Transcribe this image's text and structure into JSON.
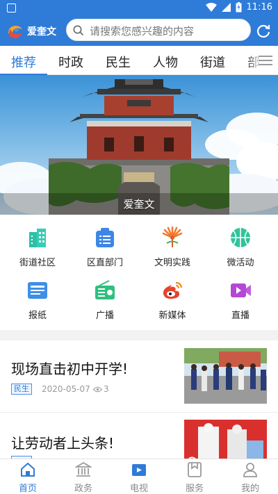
{
  "status_bar": {
    "time": "11:16"
  },
  "header": {
    "brand": "爱奎文",
    "search_placeholder": "请搜索您感兴趣的内容"
  },
  "tabs": [
    {
      "label": "推荐",
      "active": true
    },
    {
      "label": "时政"
    },
    {
      "label": "民生"
    },
    {
      "label": "人物"
    },
    {
      "label": "街道"
    },
    {
      "label": "部"
    }
  ],
  "banner": {
    "caption": "爱奎文"
  },
  "quick_links": [
    {
      "label": "街道社区",
      "icon": "buildings-icon"
    },
    {
      "label": "区直部门",
      "icon": "department-icon"
    },
    {
      "label": "文明实践",
      "icon": "civilization-icon"
    },
    {
      "label": "微活动",
      "icon": "basketball-icon"
    },
    {
      "label": "报纸",
      "icon": "newspaper-icon"
    },
    {
      "label": "广播",
      "icon": "radio-icon"
    },
    {
      "label": "新媒体",
      "icon": "weibo-icon"
    },
    {
      "label": "直播",
      "icon": "live-video-icon"
    }
  ],
  "news": [
    {
      "title": "现场直击初中开学!",
      "tag": "民生",
      "date": "2020-05-07",
      "views": "3"
    },
    {
      "title": "让劳动者上头条!"
    }
  ],
  "bottom_nav": [
    {
      "label": "首页",
      "icon": "home-icon",
      "active": true
    },
    {
      "label": "政务",
      "icon": "government-icon"
    },
    {
      "label": "电视",
      "icon": "tv-icon"
    },
    {
      "label": "服务",
      "icon": "service-icon"
    },
    {
      "label": "我的",
      "icon": "profile-icon"
    }
  ],
  "colors": {
    "accent": "#2e7bd8",
    "tag_border": "#4a90e2"
  }
}
